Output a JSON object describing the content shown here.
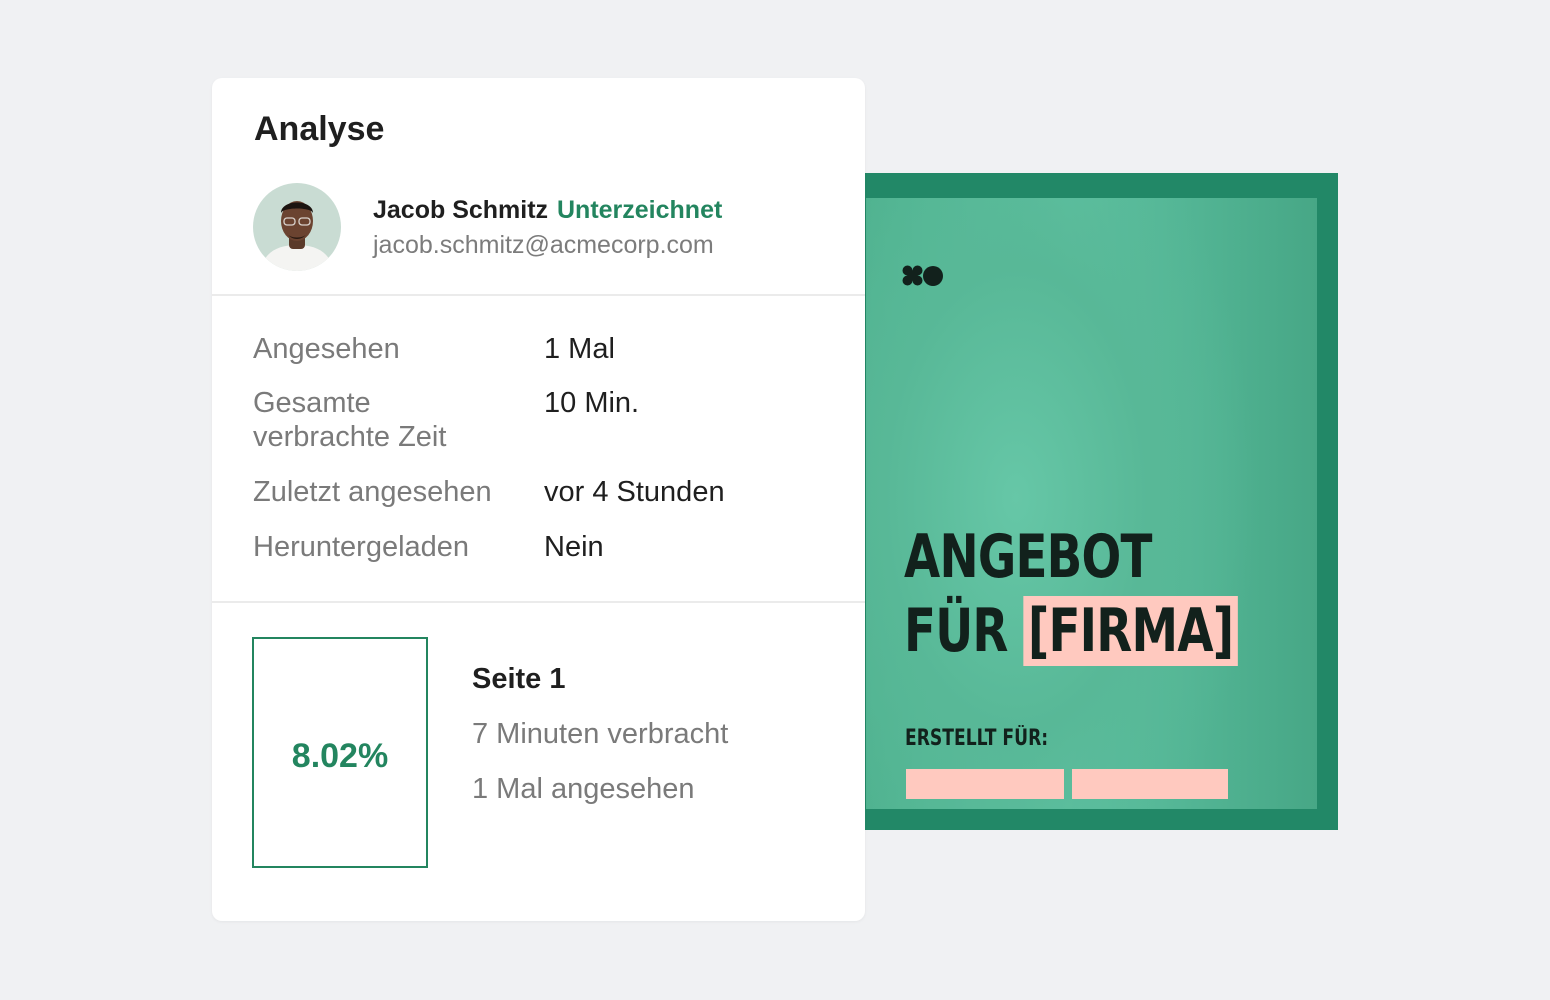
{
  "analysis": {
    "title": "Analyse",
    "user": {
      "name": "Jacob Schmitz",
      "status": "Unterzeichnet",
      "email": "jacob.schmitz@acmecorp.com"
    },
    "stats": [
      {
        "label": "Angesehen",
        "value": "1 Mal"
      },
      {
        "label": "Gesamte verbrachte Zeit",
        "value": "10 Min."
      },
      {
        "label": "Zuletzt angesehen",
        "value": "vor 4 Stunden"
      },
      {
        "label": "Heruntergeladen",
        "value": "Nein"
      }
    ],
    "page": {
      "percent": "8.02%",
      "title": "Seite 1",
      "time_spent": "7 Minuten verbracht",
      "views": "1 Mal angesehen"
    }
  },
  "document": {
    "title_line1": "ANGEBOT",
    "title_line2_prefix": "FÜR",
    "title_line2_highlight": "[FIRMA]",
    "created_for_label": "ERSTELLT FÜR:",
    "logo_icon": "clover-dot-logo-icon"
  },
  "colors": {
    "accent_green": "#23855f",
    "doc_frame": "#228867",
    "doc_inner": "#5ec2a2",
    "highlight_pink": "#ffc9bf",
    "background": "#f0f1f3"
  }
}
